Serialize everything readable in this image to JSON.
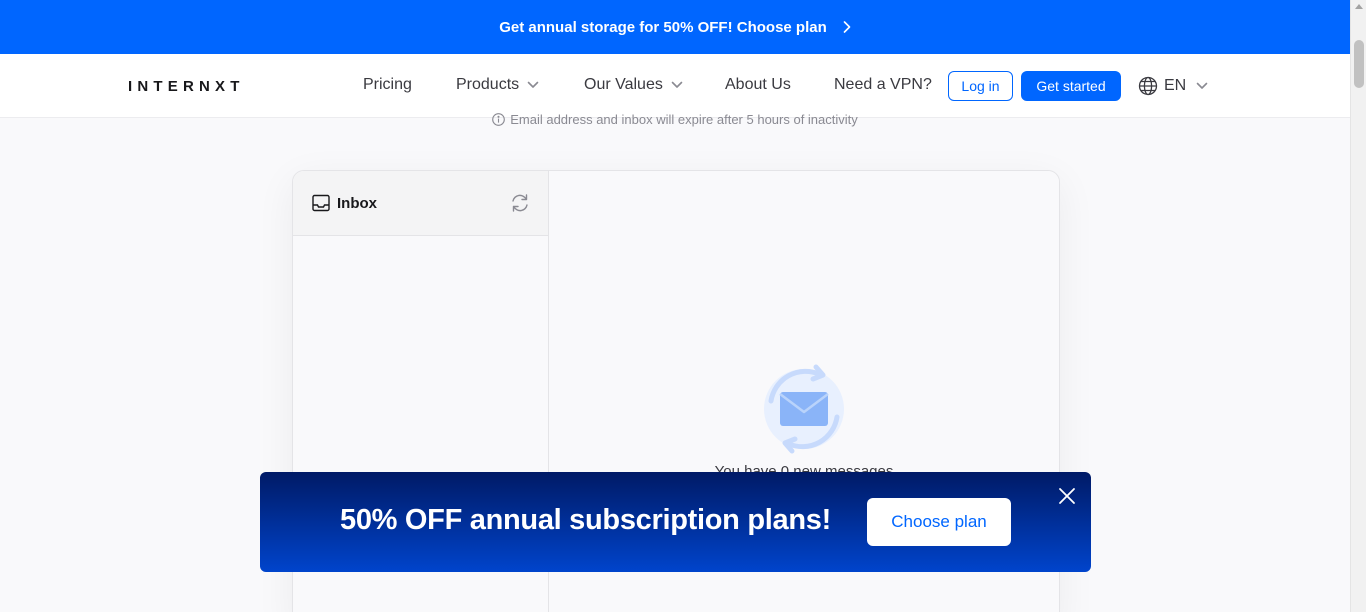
{
  "top_banner": {
    "text": "Get annual storage for 50% OFF! Choose plan",
    "icon": "chevron-right-icon"
  },
  "navbar": {
    "logo": "INTERNXT",
    "items": [
      {
        "label": "Pricing",
        "has_dropdown": false
      },
      {
        "label": "Products",
        "has_dropdown": true
      },
      {
        "label": "Our Values",
        "has_dropdown": true
      },
      {
        "label": "About Us",
        "has_dropdown": false
      },
      {
        "label": "Need a VPN?",
        "has_dropdown": false
      }
    ],
    "login_label": "Log in",
    "get_started_label": "Get started",
    "language": "EN"
  },
  "notice": {
    "text": "Email address and inbox will expire after 5 hours of inactivity",
    "icon": "info-icon"
  },
  "inbox": {
    "title": "Inbox",
    "empty_message": "You have 0 new messages"
  },
  "promo": {
    "headline": "50% OFF annual subscription plans!",
    "button_label": "Choose plan"
  },
  "colors": {
    "brand_blue": "#0066ff",
    "promo_gradient_top": "#001a66",
    "promo_gradient_bottom": "#0044cc"
  }
}
